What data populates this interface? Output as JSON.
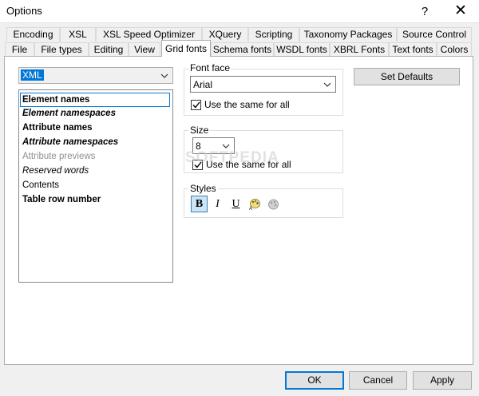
{
  "window": {
    "title": "Options",
    "help_glyph": "?",
    "close_glyph": "✕"
  },
  "tabs_row1": [
    "Encoding",
    "XSL",
    "XSL Speed Optimizer",
    "XQuery",
    "Scripting",
    "Taxonomy Packages",
    "Source Control"
  ],
  "tabs_row2": [
    "File",
    "File types",
    "Editing",
    "View",
    "Grid fonts",
    "Schema fonts",
    "WSDL fonts",
    "XBRL Fonts",
    "Text fonts",
    "Colors"
  ],
  "active_tab": "Grid fonts",
  "grid_fonts": {
    "type_combo_value": "XML",
    "elements": [
      {
        "label": "Element names",
        "style": "bold",
        "selected": true
      },
      {
        "label": "Element namespaces",
        "style": "bolditalic"
      },
      {
        "label": "Attribute names",
        "style": "bold"
      },
      {
        "label": "Attribute namespaces",
        "style": "bolditalic"
      },
      {
        "label": "Attribute previews",
        "style": "gray"
      },
      {
        "label": "Reserved words",
        "style": "italic"
      },
      {
        "label": "Contents",
        "style": "normal"
      },
      {
        "label": "Table row number",
        "style": "bold"
      }
    ],
    "font_face": {
      "label": "Font face",
      "value": "Arial",
      "same_for_all_label": "Use the same for all",
      "same_for_all_checked": true
    },
    "size": {
      "label": "Size",
      "value": "8",
      "same_for_all_label": "Use the same for all",
      "same_for_all_checked": true
    },
    "styles": {
      "label": "Styles",
      "bold_label": "B",
      "italic_label": "I",
      "underline_label": "U",
      "bold_active": true,
      "color_icon": "palette-icon",
      "bgcolor_icon": "fill-pattern-icon"
    },
    "set_defaults_label": "Set Defaults"
  },
  "watermark": "SOFTPEDIA",
  "footer": {
    "ok_label": "OK",
    "cancel_label": "Cancel",
    "apply_label": "Apply"
  },
  "colors": {
    "selection_focus": "#0078d7",
    "gray_text": "#909090"
  }
}
